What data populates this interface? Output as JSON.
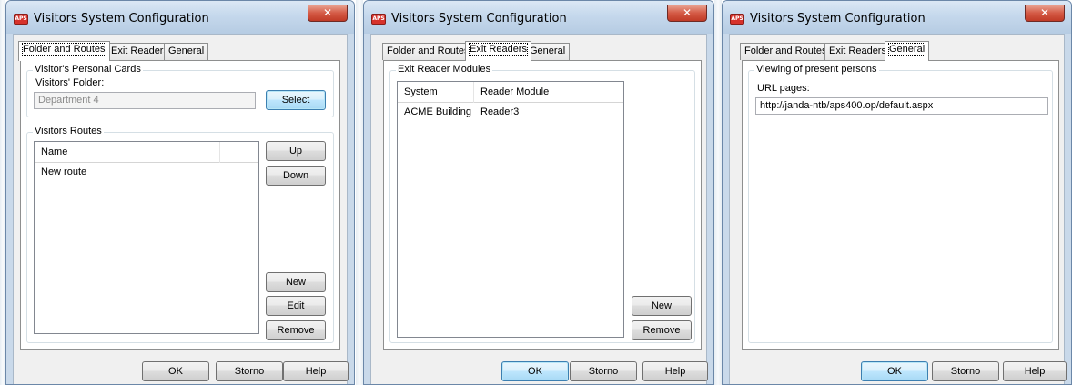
{
  "window": {
    "title": "Visitors System Configuration",
    "close_glyph": "✕",
    "app_icon": "app-icon",
    "app_icon_text": "APS"
  },
  "tabs": [
    "Folder and Routes",
    "Exit Readers",
    "General"
  ],
  "buttons": {
    "ok": "OK",
    "cancel": "Storno",
    "help": "Help"
  },
  "folder_routes": {
    "personal_cards_group": "Visitor's Personal Cards",
    "folder_label": "Visitors' Folder:",
    "folder_value": "Department 4",
    "select_button": "Select",
    "routes_group": "Visitors Routes",
    "routes_columns": [
      "Name",
      ""
    ],
    "routes_rows": [
      "New route"
    ],
    "up_button": "Up",
    "down_button": "Down",
    "new_button": "New",
    "edit_button": "Edit",
    "remove_button": "Remove"
  },
  "exit_readers": {
    "group": "Exit Reader Modules",
    "columns": [
      "System",
      "Reader Module"
    ],
    "rows": [
      [
        "ACME Building",
        "Reader3"
      ]
    ],
    "new_button": "New",
    "remove_button": "Remove"
  },
  "general": {
    "group": "Viewing of present persons",
    "url_label": "URL pages:",
    "url_value": "http://janda-ntb/aps400.op/default.aspx"
  },
  "colors": {
    "close_button": "#c03a26",
    "title_gradient_top": "#dbe8f5",
    "default_button": "#3c7fb1"
  }
}
